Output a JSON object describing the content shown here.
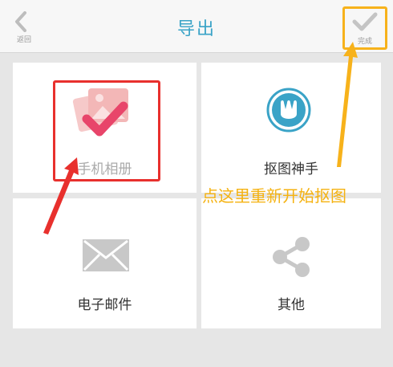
{
  "header": {
    "back_label": "返回",
    "title": "导出",
    "done_label": "完成"
  },
  "options": [
    {
      "label": "手机相册",
      "icon": "photo-album-check-icon"
    },
    {
      "label": "抠图神手",
      "icon": "cutout-app-icon"
    },
    {
      "label": "电子邮件",
      "icon": "envelope-icon"
    },
    {
      "label": "其他",
      "icon": "share-icon"
    }
  ],
  "annotation": {
    "text": "点这里重新开始抠图",
    "highlight_color": "#f7b21b",
    "arrow_color": "#e8302d"
  },
  "colors": {
    "accent": "#3aa3c7",
    "check_pink": "#e8456a",
    "icon_gray": "#c8c8c8"
  }
}
